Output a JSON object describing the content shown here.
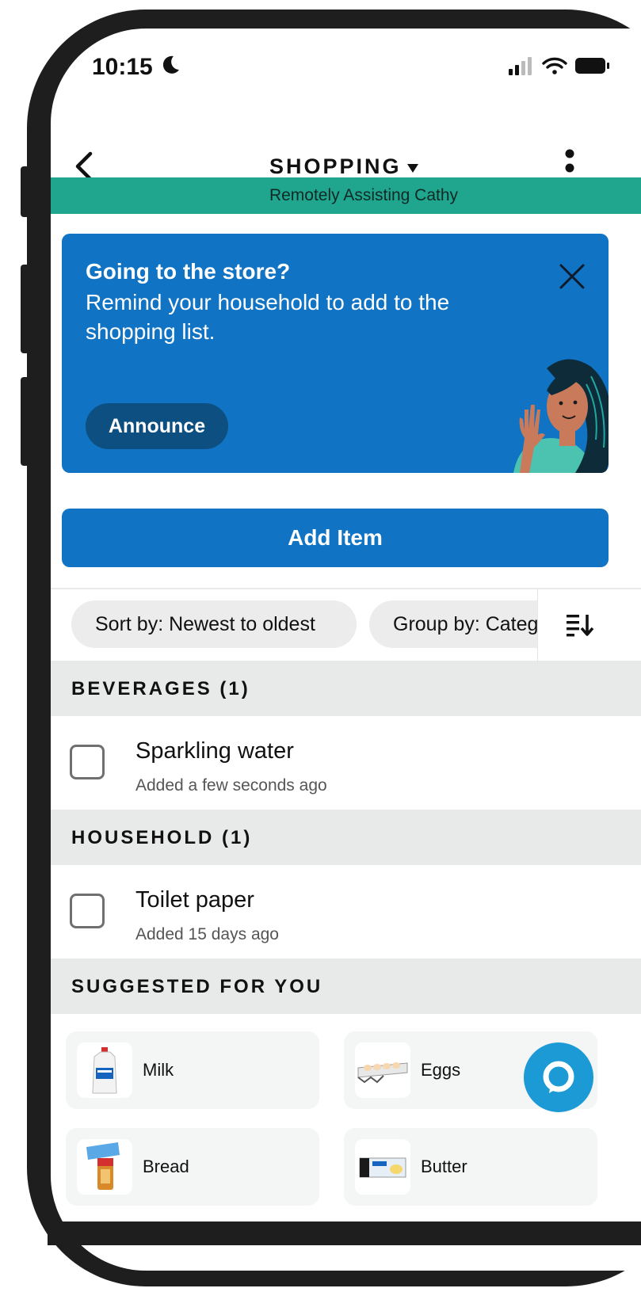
{
  "status_bar": {
    "time": "10:15"
  },
  "header": {
    "title": "SHOPPING"
  },
  "remote_banner": {
    "text": "Remotely Assisting Cathy"
  },
  "promo": {
    "title": "Going to the store?",
    "body": "Remind your household to add to the shopping list.",
    "announce_label": "Announce"
  },
  "add_item_label": "Add Item",
  "chips": {
    "sort_label": "Sort by: Newest to oldest",
    "group_label": "Group by: Category"
  },
  "sections": [
    {
      "title": "BEVERAGES (1)",
      "items": [
        {
          "name": "Sparkling water",
          "added": "Added a few seconds ago",
          "checked": false
        }
      ]
    },
    {
      "title": "HOUSEHOLD (1)",
      "items": [
        {
          "name": "Toilet paper",
          "added": "Added 15 days ago",
          "checked": false
        }
      ]
    }
  ],
  "suggested": {
    "title": "SUGGESTED FOR YOU",
    "items": [
      {
        "label": "Milk",
        "icon": "milk-jug-icon"
      },
      {
        "label": "Eggs",
        "icon": "egg-carton-icon"
      },
      {
        "label": "Bread",
        "icon": "bread-loaf-icon"
      },
      {
        "label": "Butter",
        "icon": "butter-pack-icon"
      }
    ]
  },
  "colors": {
    "accent_blue": "#1073c4",
    "banner_teal": "#20a68f",
    "announce_dark": "#0d4f80",
    "alexa_blue": "#1b9ad6",
    "section_gray": "#e8eaea"
  }
}
